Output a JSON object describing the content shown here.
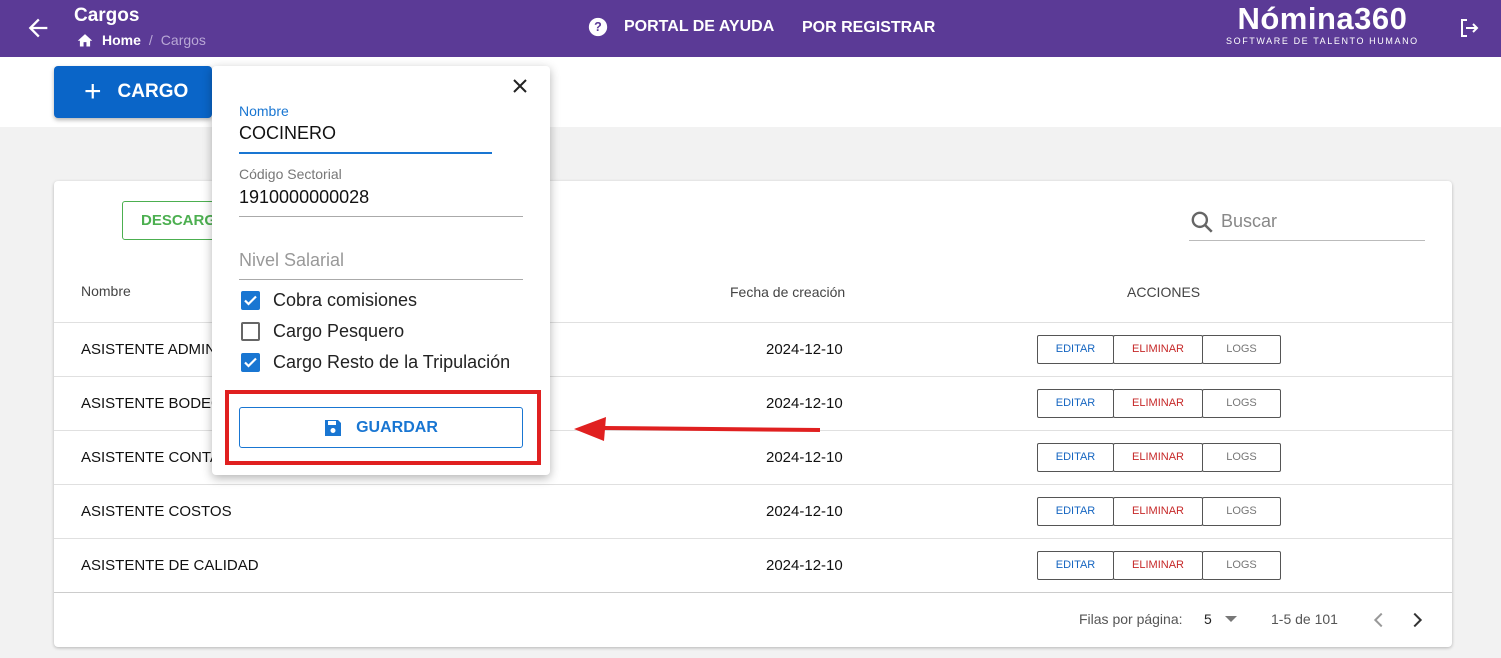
{
  "header": {
    "title": "Cargos",
    "breadcrumb": {
      "home": "Home",
      "current": "Cargos"
    },
    "nav_help": "PORTAL DE AYUDA",
    "nav_register": "POR REGISTRAR",
    "brand_name": "Nómina360",
    "brand_tagline": "SOFTWARE DE TALENTO HUMANO",
    "color": "#5b3a96"
  },
  "toolbar": {
    "add_label": "CARGO"
  },
  "card": {
    "download_label": "DESCARGA",
    "search_placeholder": "Buscar",
    "columns": {
      "name": "Nombre",
      "date": "Fecha de creación",
      "actions": "ACCIONES"
    },
    "rows": [
      {
        "name": "ASISTENTE ADMINIS",
        "date": "2024-12-10"
      },
      {
        "name": "ASISTENTE BODEGA",
        "date": "2024-12-10"
      },
      {
        "name": "ASISTENTE CONTAB",
        "date": "2024-12-10"
      },
      {
        "name": "ASISTENTE COSTOS",
        "date": "2024-12-10"
      },
      {
        "name": "ASISTENTE DE CALIDAD",
        "date": "2024-12-10"
      }
    ],
    "actions": {
      "edit": "EDITAR",
      "delete": "ELIMINAR",
      "logs": "LOGS"
    },
    "footer": {
      "rows_per_page_label": "Filas por página:",
      "rows_per_page": "5",
      "range": "1-5 de 101"
    }
  },
  "popup": {
    "name_label": "Nombre",
    "name_value": "COCINERO",
    "code_label": "Código Sectorial",
    "code_value": "1910000000028",
    "level_placeholder": "Nivel Salarial",
    "checkboxes": [
      {
        "label": "Cobra comisiones",
        "checked": true
      },
      {
        "label": "Cargo Pesquero",
        "checked": false
      },
      {
        "label": "Cargo Resto de la Tripulación",
        "checked": true
      }
    ],
    "save_label": "GUARDAR"
  },
  "colors": {
    "accent": "#1976d2",
    "primary_button": "#0a65c8",
    "danger": "#c62828",
    "success": "#4caf50",
    "annotation": "#e02020"
  }
}
